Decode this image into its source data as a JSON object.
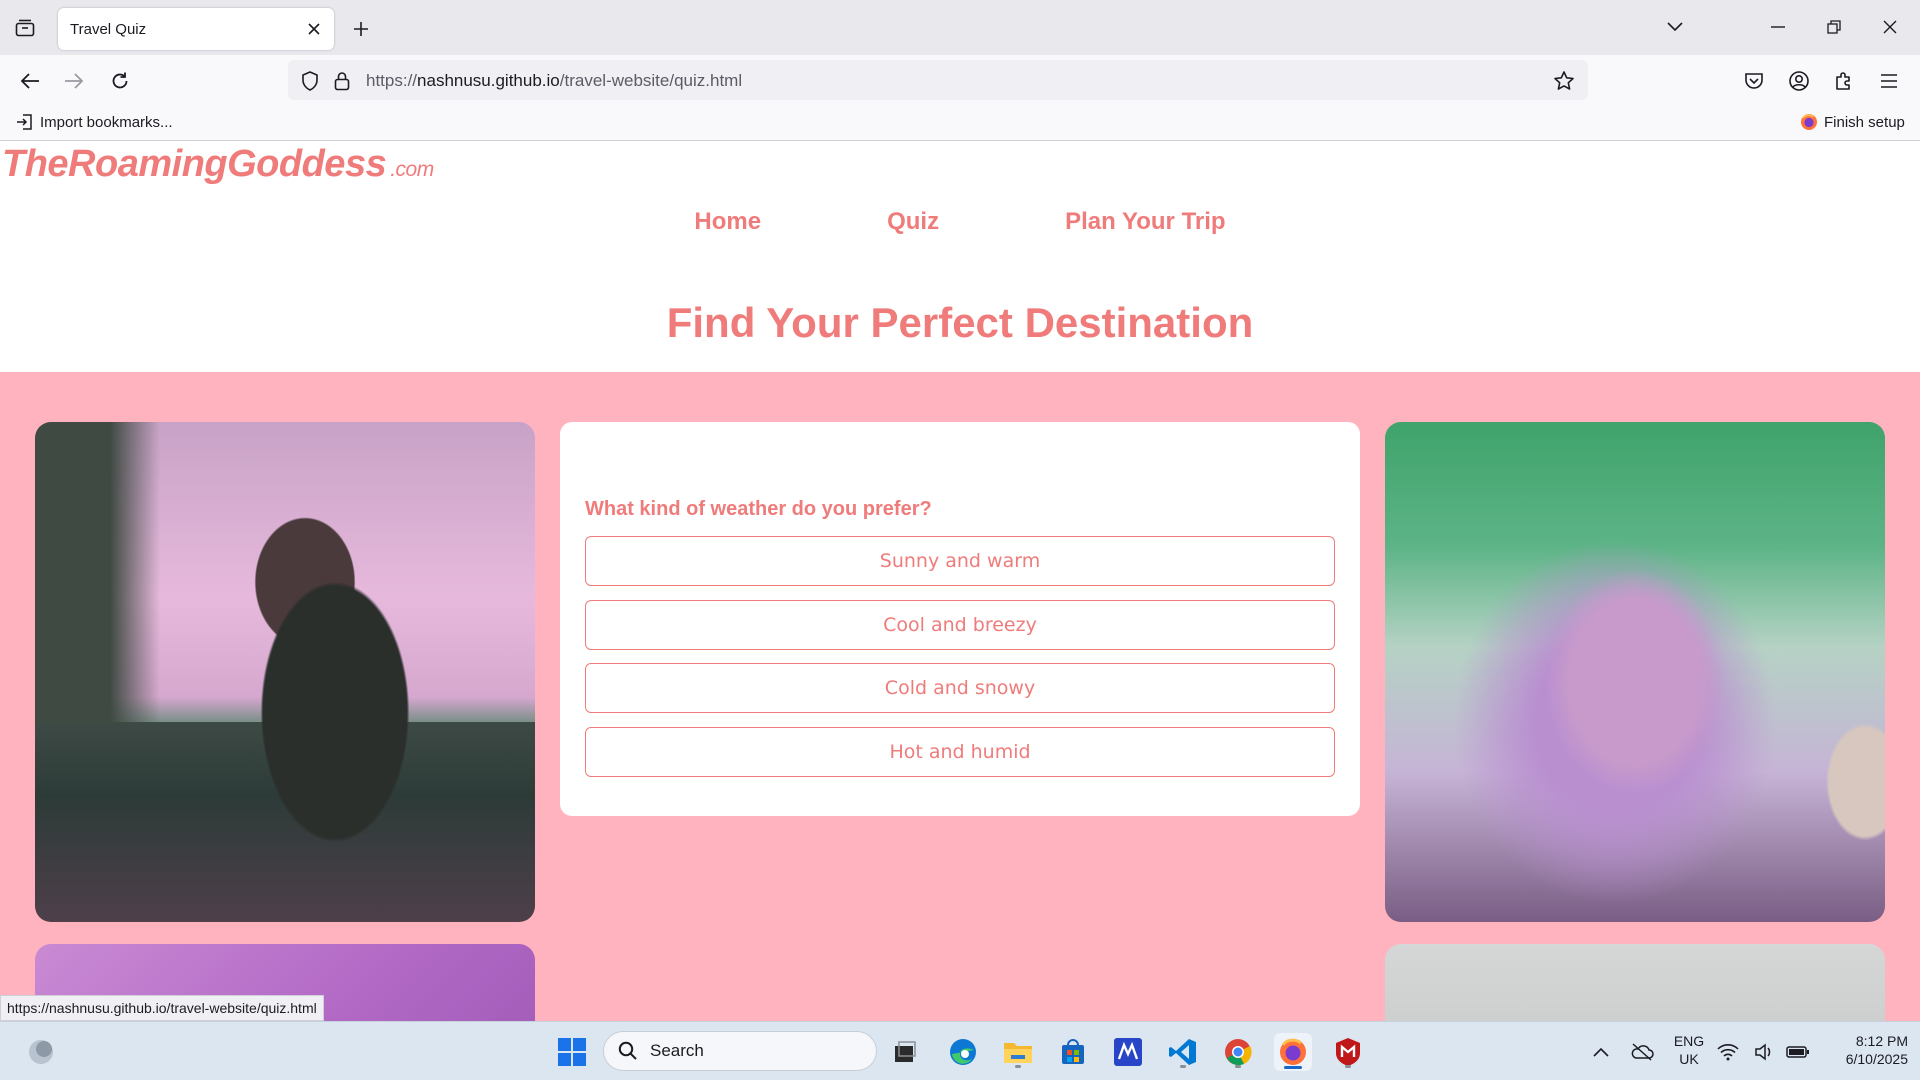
{
  "browser": {
    "tab_title": "Travel Quiz",
    "url_prefix": "https://",
    "url_host": "nashnusu.github.io",
    "url_path": "/travel-website/quiz.html",
    "bookmark_import": "Import bookmarks...",
    "finish_setup": "Finish setup",
    "status_url": "https://nashnusu.github.io/travel-website/quiz.html"
  },
  "site": {
    "logo": "TheRoamingGoddess",
    "logo_suffix": ".com",
    "nav": [
      "Home",
      "Quiz",
      "Plan Your Trip"
    ],
    "title": "Find Your Perfect Destination"
  },
  "quiz": {
    "question": "What kind of weather do you prefer?",
    "options": [
      "Sunny and warm",
      "Cool and breezy",
      "Cold and snowy",
      "Hot and humid"
    ]
  },
  "taskbar": {
    "search_placeholder": "Search",
    "lang_1": "ENG",
    "lang_2": "UK",
    "time": "8:12 PM",
    "date": "6/10/2025"
  },
  "colors": {
    "accent": "#ef7b7b",
    "pink_bg": "#ffb3be"
  }
}
